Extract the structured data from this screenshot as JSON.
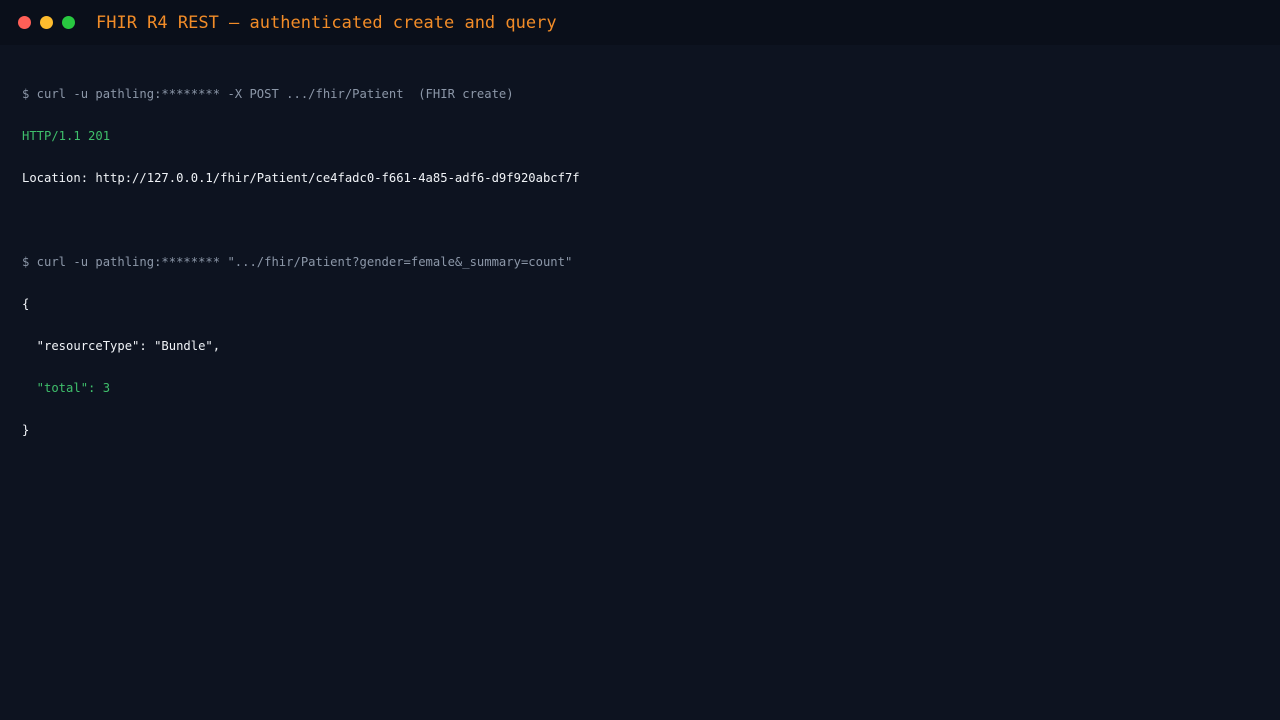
{
  "window": {
    "title": "FHIR R4 REST — authenticated create and query",
    "controls": [
      "close-dot",
      "minimize-dot",
      "maximize-dot"
    ],
    "colors": {
      "background": "#0d1320",
      "titlebar": "#0a0f1a",
      "title": "#f28c28",
      "command": "#8c97a8",
      "success": "#3fbf6b",
      "text": "#f0f3f7"
    }
  },
  "terminal": {
    "create_command": "$ curl -u pathling:******** -X POST .../fhir/Patient  (FHIR create)",
    "create_status": "HTTP/1.1 201",
    "create_location": "Location: http://127.0.0.1/fhir/Patient/ce4fadc0-f661-4a85-adf6-d9f920abcf7f",
    "query_command": "$ curl -u pathling:******** \".../fhir/Patient?gender=female&_summary=count\"",
    "json_open": "{",
    "json_resource_type": "  \"resourceType\": \"Bundle\",",
    "json_total": "  \"total\": 3",
    "json_close": "}"
  }
}
